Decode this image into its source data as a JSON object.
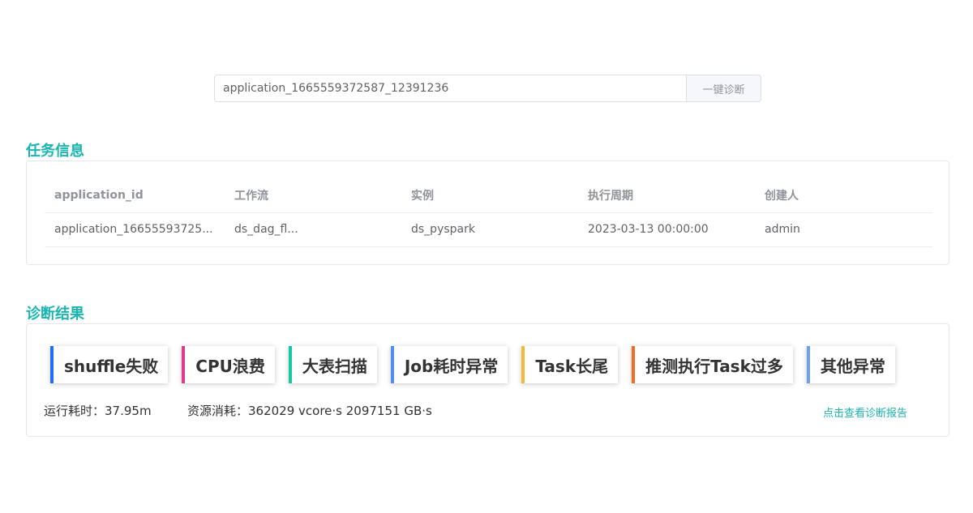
{
  "search": {
    "value": "application_1665559372587_12391236",
    "button_label": "一键诊断"
  },
  "task_info": {
    "title": "任务信息",
    "columns": [
      "application_id",
      "工作流",
      "实例",
      "执行周期",
      "创建人"
    ],
    "rows": [
      [
        "application_16655593725...",
        "ds_dag_fl...",
        "ds_pyspark",
        "2023-03-13 00:00:00",
        "admin"
      ]
    ]
  },
  "diagnosis": {
    "title": "诊断结果",
    "tags": [
      {
        "label": "shuffle失败",
        "color": "#1e6fff"
      },
      {
        "label": "CPU浪费",
        "color": "#e03a8f"
      },
      {
        "label": "大表扫描",
        "color": "#17c9a4"
      },
      {
        "label": "Job耗时异常",
        "color": "#4f8ef7"
      },
      {
        "label": "Task长尾",
        "color": "#f5b939"
      },
      {
        "label": "推测执行Task过多",
        "color": "#f56b1f"
      },
      {
        "label": "其他异常",
        "color": "#6aa0f5"
      }
    ],
    "runtime_text": "运行耗时：37.95m",
    "resource_text": "资源消耗：362029 vcore·s 2097151 GB·s",
    "report_link": "点击查看诊断报告"
  }
}
